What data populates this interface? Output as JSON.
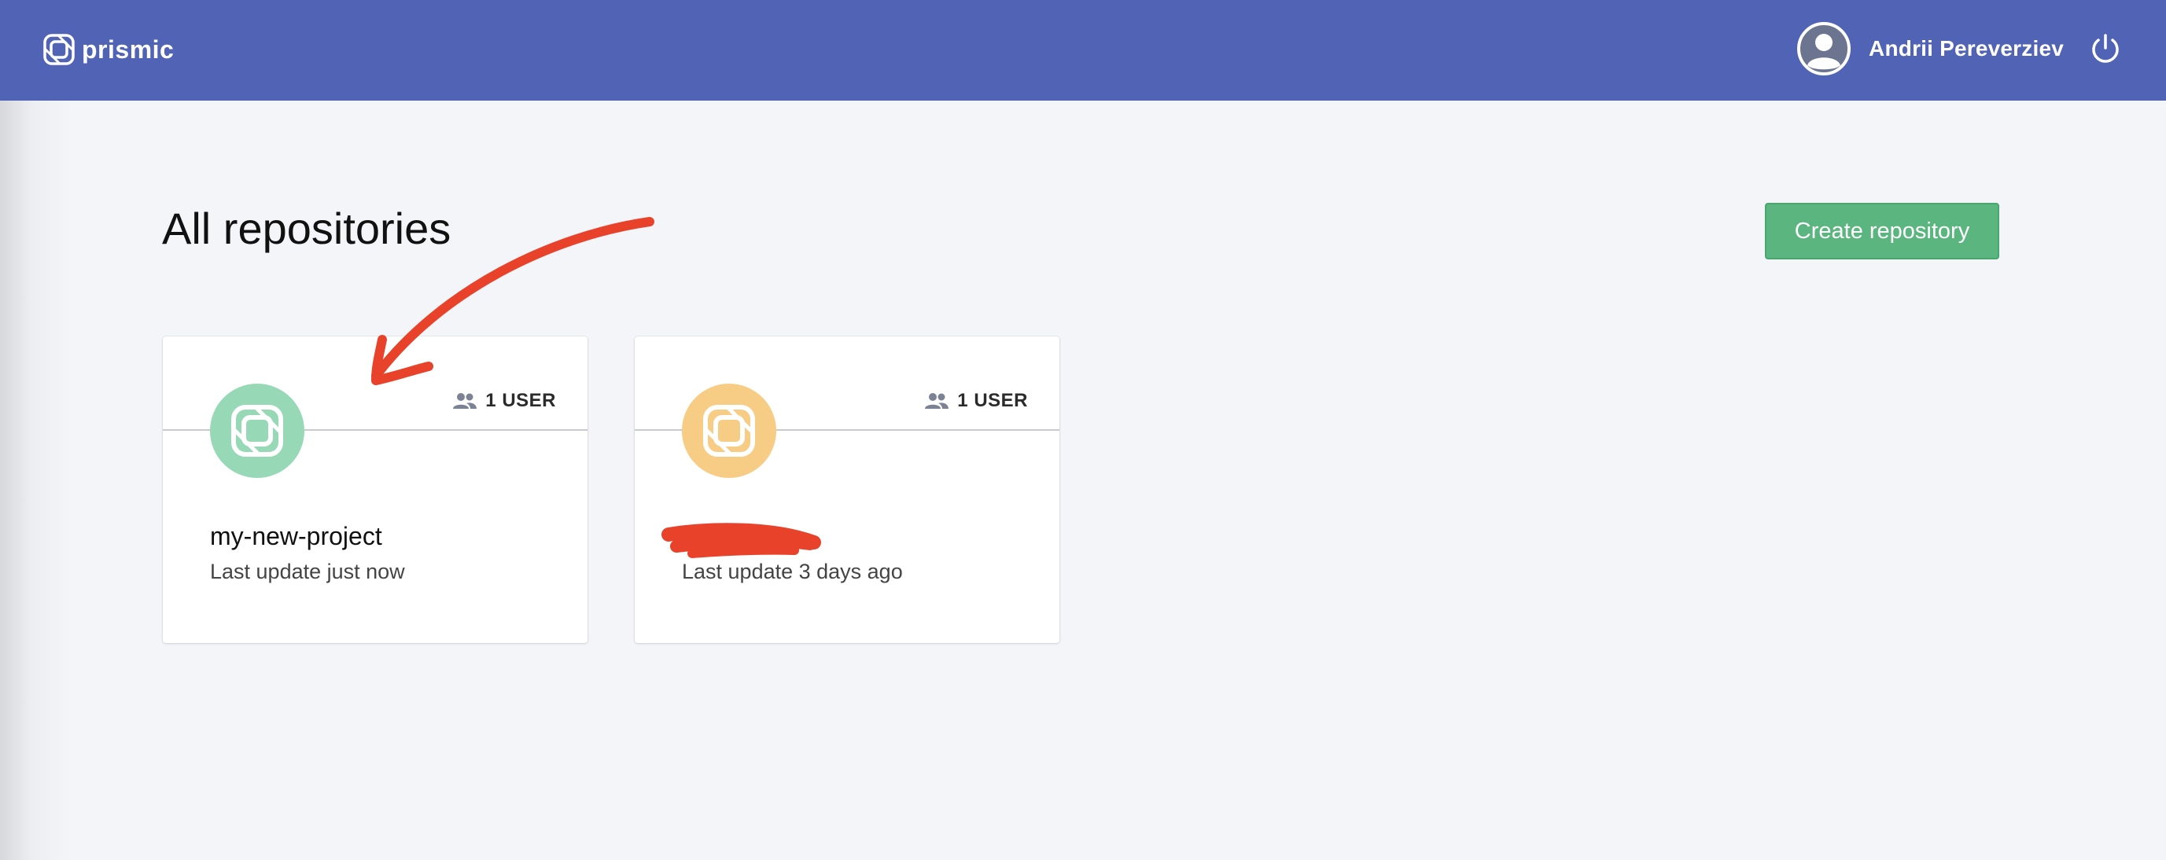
{
  "header": {
    "brand": "prismic",
    "user_name": "Andrii Pereverziev",
    "icons": [
      "prismic-logo-icon",
      "user-avatar-icon",
      "power-icon"
    ]
  },
  "main": {
    "title": "All repositories",
    "create_button": "Create repository"
  },
  "repositories": [
    {
      "name": "my-new-project",
      "users": "1 USER",
      "last_update": "Last update just now",
      "icon_color": "#97d9b6"
    },
    {
      "name": "",
      "users": "1 USER",
      "last_update": "Last update 3 days ago",
      "icon_color": "#f7cc85"
    }
  ],
  "colors": {
    "header_bg": "#5163b5",
    "page_bg": "#f4f5f9",
    "button_bg": "#5bb57f",
    "annotation": "#e8432a"
  }
}
